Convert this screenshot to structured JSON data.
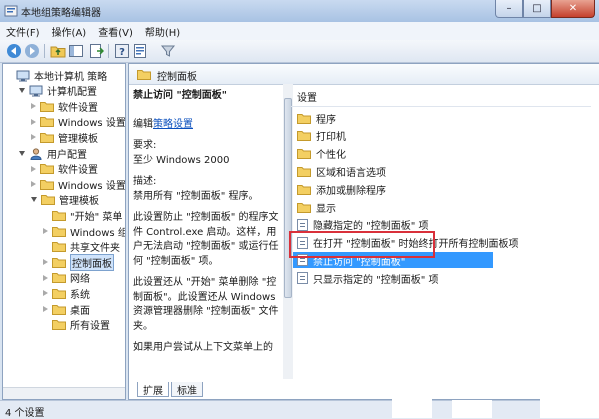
{
  "window": {
    "title": "本地组策略编辑器"
  },
  "menu": [
    "文件(F)",
    "操作(A)",
    "查看(V)",
    "帮助(H)"
  ],
  "tree": [
    {
      "label": "本地计算机 策略",
      "level": 0,
      "twisty": "none",
      "icon": "computer"
    },
    {
      "label": "计算机配置",
      "level": 1,
      "twisty": "open",
      "icon": "computer"
    },
    {
      "label": "软件设置",
      "level": 2,
      "twisty": "closed",
      "icon": "folder"
    },
    {
      "label": "Windows 设置",
      "level": 2,
      "twisty": "closed",
      "icon": "folder"
    },
    {
      "label": "管理模板",
      "level": 2,
      "twisty": "closed",
      "icon": "folder"
    },
    {
      "label": "用户配置",
      "level": 1,
      "twisty": "open",
      "icon": "user"
    },
    {
      "label": "软件设置",
      "level": 2,
      "twisty": "closed",
      "icon": "folder"
    },
    {
      "label": "Windows 设置",
      "level": 2,
      "twisty": "closed",
      "icon": "folder"
    },
    {
      "label": "管理模板",
      "level": 2,
      "twisty": "open",
      "icon": "folder"
    },
    {
      "label": "\"开始\" 菜单",
      "level": 3,
      "twisty": "none",
      "icon": "folder"
    },
    {
      "label": "Windows 组件",
      "level": 3,
      "twisty": "closed",
      "icon": "folder"
    },
    {
      "label": "共享文件夹",
      "level": 3,
      "twisty": "none",
      "icon": "folder"
    },
    {
      "label": "控制面板",
      "level": 3,
      "twisty": "closed",
      "icon": "folder",
      "selected": true
    },
    {
      "label": "网络",
      "level": 3,
      "twisty": "closed",
      "icon": "folder"
    },
    {
      "label": "系统",
      "level": 3,
      "twisty": "closed",
      "icon": "folder"
    },
    {
      "label": "桌面",
      "level": 3,
      "twisty": "closed",
      "icon": "folder"
    },
    {
      "label": "所有设置",
      "level": 3,
      "twisty": "none",
      "icon": "folder"
    }
  ],
  "right": {
    "header": "控制面板",
    "desc_title": "禁止访问 \"控制面板\"",
    "edit_prefix": "编辑",
    "edit_link": "策略设置",
    "req_label": "要求:",
    "req_value": "至少 Windows 2000",
    "desc_label": "描述:",
    "desc_1": "禁用所有 \"控制面板\" 程序。",
    "desc_2": "此设置防止 \"控制面板\" 的程序文件 Control.exe 启动。这样，用户无法启动 \"控制面板\" 或运行任何 \"控制面板\" 项。",
    "desc_3": "此设置还从 \"开始\" 菜单删除 \"控制面板\"。此设置还从 Windows 资源管理器删除 \"控制面板\" 文件夹。",
    "desc_4": "如果用户尝试从上下文菜单上的"
  },
  "list": {
    "header": "设置",
    "items": [
      {
        "label": "程序",
        "type": "folder"
      },
      {
        "label": "打印机",
        "type": "folder"
      },
      {
        "label": "个性化",
        "type": "folder"
      },
      {
        "label": "区域和语言选项",
        "type": "folder"
      },
      {
        "label": "添加或删除程序",
        "type": "folder"
      },
      {
        "label": "显示",
        "type": "folder"
      },
      {
        "label": "隐藏指定的 \"控制面板\" 项",
        "type": "policy"
      },
      {
        "label": "在打开 \"控制面板\" 时始终打开所有控制面板项",
        "type": "policy"
      },
      {
        "label": "禁止访问 \"控制面板\"",
        "type": "policy",
        "selected": true
      },
      {
        "label": "只显示指定的 \"控制面板\" 项",
        "type": "policy"
      }
    ]
  },
  "tabs": [
    "扩展",
    "标准"
  ],
  "status": "4 个设置",
  "colors": {
    "selection": "#3399ff",
    "highlight_box": "#d9303a",
    "link": "#0b4fbd"
  }
}
